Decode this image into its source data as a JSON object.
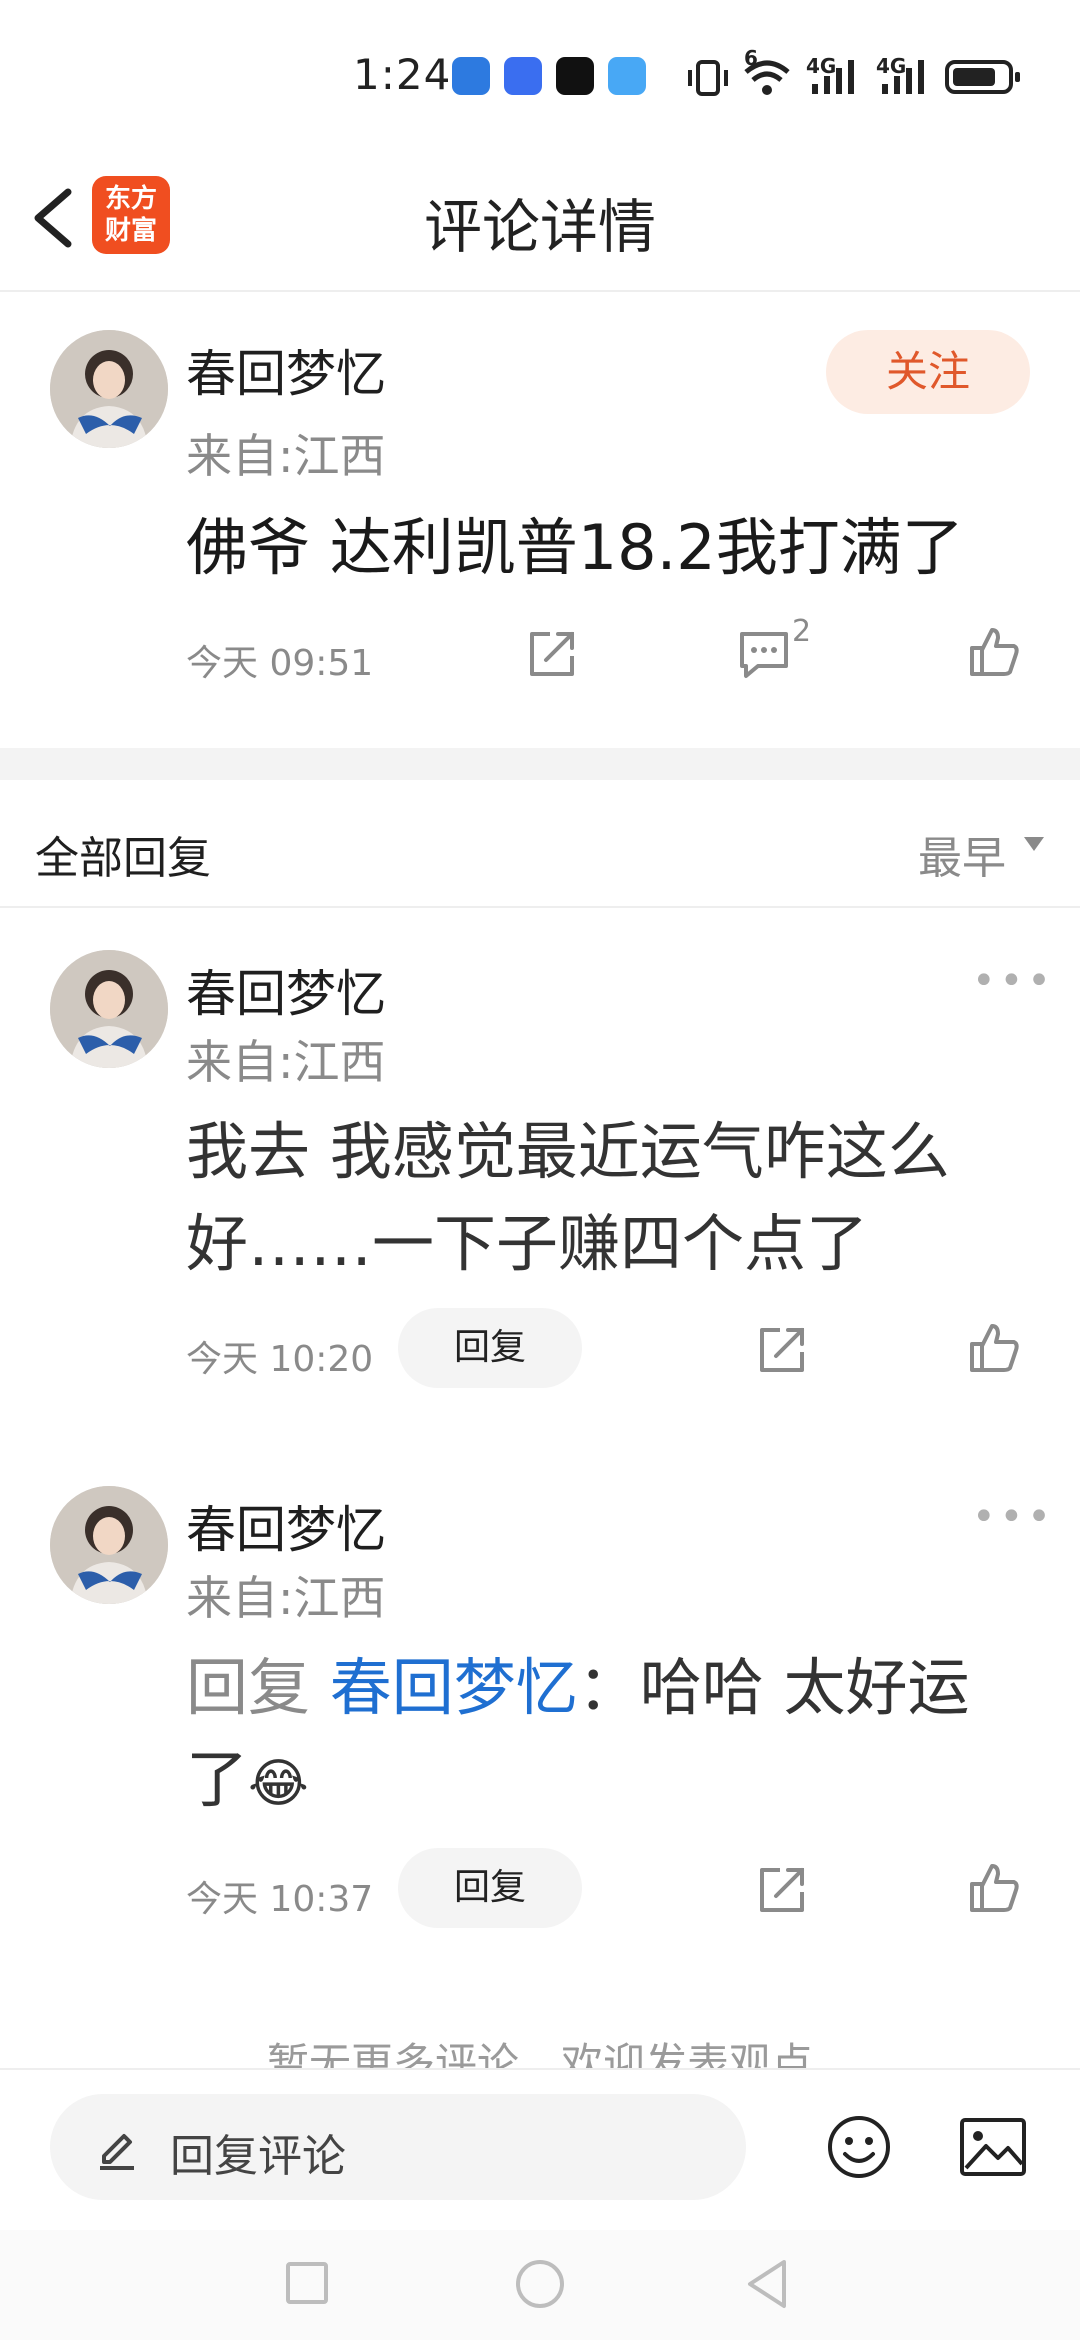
{
  "status_bar": {
    "time": "1:24",
    "signal_1": "4G",
    "signal_2": "4G",
    "wifi_badge": "6"
  },
  "header": {
    "logo_line1": "东方",
    "logo_line2": "财富",
    "title": "评论详情"
  },
  "main_comment": {
    "username": "春回梦忆",
    "location": "来自:江西",
    "follow_label": "关注",
    "text": "佛爷 达利凯普18.2我打满了",
    "time": "今天 09:51",
    "reply_count": "2"
  },
  "replies_section": {
    "title": "全部回复",
    "sort_label": "最早"
  },
  "replies": [
    {
      "username": "春回梦忆",
      "location": "来自:江西",
      "text_line1": "我去 我感觉最近运气咋这么",
      "text_line2": "好……一下子赚四个点了",
      "time": "今天 10:20",
      "reply_label": "回复"
    },
    {
      "username": "春回梦忆",
      "location": "来自:江西",
      "prefix": "回复",
      "mention": "春回梦忆",
      "text_line1": "：哈哈 太好运",
      "text_line2": "了",
      "emoji": "😂",
      "time": "今天 10:37",
      "reply_label": "回复"
    }
  ],
  "footer": {
    "no_more": "暂无更多评论，欢迎发表观点",
    "input_placeholder": "回复评论"
  },
  "colors": {
    "accent": "#e0582b",
    "mention": "#1f6fd1",
    "logo": "#f04e20"
  }
}
